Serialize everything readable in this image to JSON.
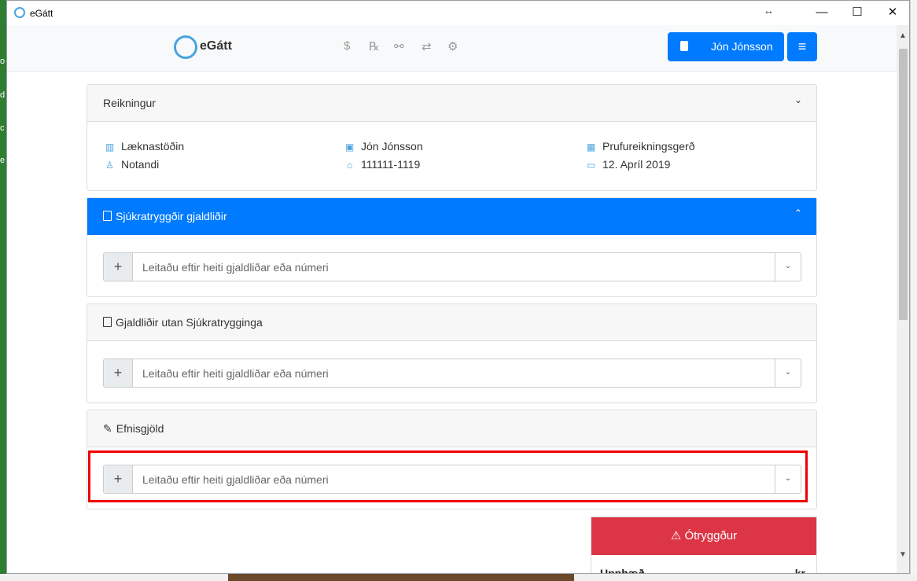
{
  "window": {
    "title": "eGátt",
    "resize_glyph": "↔",
    "minimize": "—",
    "maximize": "☐",
    "close": "✕"
  },
  "navbar": {
    "brand": "eGátt",
    "icons": [
      "dollar-icon",
      "prescription-icon",
      "pills-icon",
      "exchange-icon",
      "settings-icon"
    ],
    "icon_glyphs": [
      "$",
      "℞",
      "⚯",
      "⇄",
      "⚙"
    ],
    "user_name": "Jón Jónsson",
    "menu_glyph": "≡"
  },
  "reikningur": {
    "title": "Reikningur",
    "chevron": "⌄",
    "info": {
      "clinic": "Læknastöðin",
      "user": "Notandi",
      "patient": "Jón Jónsson",
      "ssn": "111111-1119",
      "invoice_type": "Prufureikningsgerð",
      "date": "12. Apríl 2019"
    },
    "icon_glyphs": {
      "clinic": "▥",
      "user": "♙",
      "patient": "▣",
      "ssn": "⌂",
      "invoice_type": "▦",
      "date": "▭"
    }
  },
  "sjukratryggdir": {
    "title": "Sjúkratryggðir gjaldliðir",
    "chevron": "⌃",
    "placeholder": "Leitaðu eftir heiti gjaldliðar eða númeri"
  },
  "utan": {
    "title": "Gjaldliðir utan Sjúkratrygginga",
    "placeholder": "Leitaðu eftir heiti gjaldliðar eða númeri"
  },
  "efnisgjold": {
    "title": "Efnisgjöld",
    "placeholder": "Leitaðu eftir heiti gjaldliðar eða númeri"
  },
  "search_common": {
    "plus": "+",
    "dropdown": "⌄"
  },
  "status": {
    "label": "Ótryggður",
    "warning_glyph": "⚠",
    "amount_label": "Upphæð",
    "currency": "kr",
    "color": "#dc3545"
  },
  "accent_color": "#007bff",
  "background_left": [
    "o",
    "d",
    "c",
    "e"
  ]
}
